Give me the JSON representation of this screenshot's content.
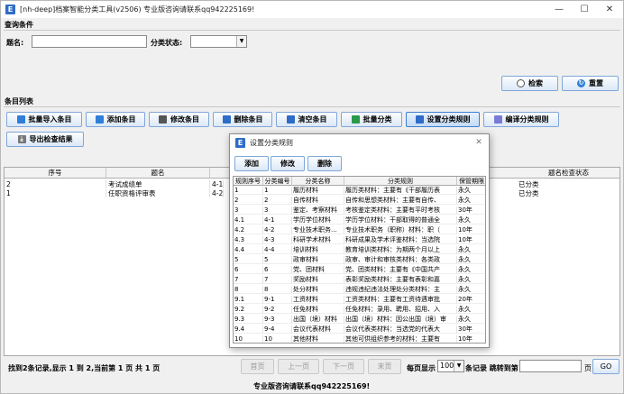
{
  "window": {
    "title": "[nh-deep]档案智能分类工具(v2506) 专业版咨询请联系qq942225169!",
    "icon_letter": "E"
  },
  "query": {
    "section_title": "查询条件",
    "title_label": "题名:",
    "title_value": "",
    "status_label": "分类状态:",
    "status_value": "",
    "search_btn": "检索",
    "reset_btn": "重置"
  },
  "items": {
    "section_title": "条目列表",
    "toolbar": [
      {
        "label": "批量导入条目",
        "icon": "import-icon",
        "color": "#2f7fd8"
      },
      {
        "label": "添加条目",
        "icon": "add-icon",
        "color": "#2f7fd8"
      },
      {
        "label": "修改条目",
        "icon": "edit-icon",
        "color": "#555555"
      },
      {
        "label": "删除条目",
        "icon": "delete-icon",
        "color": "#2f6cc8"
      },
      {
        "label": "清空条目",
        "icon": "clear-icon",
        "color": "#2f6cc8"
      },
      {
        "label": "批量分类",
        "icon": "classify-icon",
        "color": "#2a9a4a"
      },
      {
        "label": "设置分类规则",
        "icon": "rules-icon",
        "color": "#2f6cc8"
      },
      {
        "label": "编译分类规则",
        "icon": "compile-icon",
        "color": "#7a7ad8"
      }
    ],
    "export_btn": "导出检查结果",
    "columns": [
      "序号",
      "题名",
      "题名检查状态"
    ],
    "rows": [
      {
        "no": "2",
        "title": "考试成绩单",
        "code": "4-1",
        "status": "已分类"
      },
      {
        "no": "1",
        "title": "任职资格评审表",
        "code": "4-2",
        "status": "已分类"
      }
    ]
  },
  "pager": {
    "summary": "找到2条记录,显示 1 到 2,当前第 1 页 共 1 页",
    "first": "首页",
    "prev": "上一页",
    "next": "下一页",
    "last": "末页",
    "per_page_label": "每页显示",
    "per_page_value": "100",
    "per_page_suffix": "条记录 跳转到第",
    "page_input": "",
    "page_suffix": "页",
    "go": "GO"
  },
  "footer": "专业版咨询请联系qq942225169!",
  "dialog": {
    "title": "设置分类规则",
    "buttons": [
      "添加",
      "修改",
      "删除"
    ],
    "columns": [
      "规则序号",
      "分类编号",
      "分类名称",
      "分类规则",
      "保管期限"
    ],
    "rows": [
      [
        "1",
        "1",
        "履历材料",
        "履历类材料：主要有《干部履历表",
        "永久"
      ],
      [
        "2",
        "2",
        "自传材料",
        "自传和思想类材料：主要有自传、",
        "永久"
      ],
      [
        "3",
        "3",
        "鉴定、考察材料",
        "考核鉴定类材料：主要有平时考核",
        "30年"
      ],
      [
        "4.1",
        "4-1",
        "学历学位材料",
        "学历学位材料：干部取得的普通全",
        "永久"
      ],
      [
        "4.2",
        "4-2",
        "专业技术职务...",
        "专业技术职务（职称）材料：职（",
        "10年"
      ],
      [
        "4.3",
        "4-3",
        "科研学术材料",
        "科研成果及学术评鉴材料：当选院",
        "10年"
      ],
      [
        "4.4",
        "4-4",
        "培训材料",
        "教育培训类材料：为期两个月以上",
        "永久"
      ],
      [
        "5",
        "5",
        "政审材料",
        "政审、审计和审核类材料：各类政",
        "永久"
      ],
      [
        "6",
        "6",
        "党、团材料",
        "党、团类材料：主要有《中国共产",
        "永久"
      ],
      [
        "7",
        "7",
        "奖励材料",
        "表彰奖励类材料：主要有表彰和嘉",
        "永久"
      ],
      [
        "8",
        "8",
        "处分材料",
        "违规违纪违法处理处分类材料：主",
        "永久"
      ],
      [
        "9.1",
        "9-1",
        "工资材料",
        "工资类材料：主要有工资待遇审批",
        "20年"
      ],
      [
        "9.2",
        "9-2",
        "任免材料",
        "任免材料：录用、聘用、招用、入",
        "永久"
      ],
      [
        "9.3",
        "9-3",
        "出国（境）材料",
        "出国（境）材料：因公出国（境）审",
        "永久"
      ],
      [
        "9.4",
        "9-4",
        "会议代表材料",
        "会议代表类材料：当选党的代表大",
        "30年"
      ],
      [
        "10",
        "10",
        "其他材料",
        "其他可供组织参考的材料：主要有",
        "10年"
      ]
    ]
  }
}
